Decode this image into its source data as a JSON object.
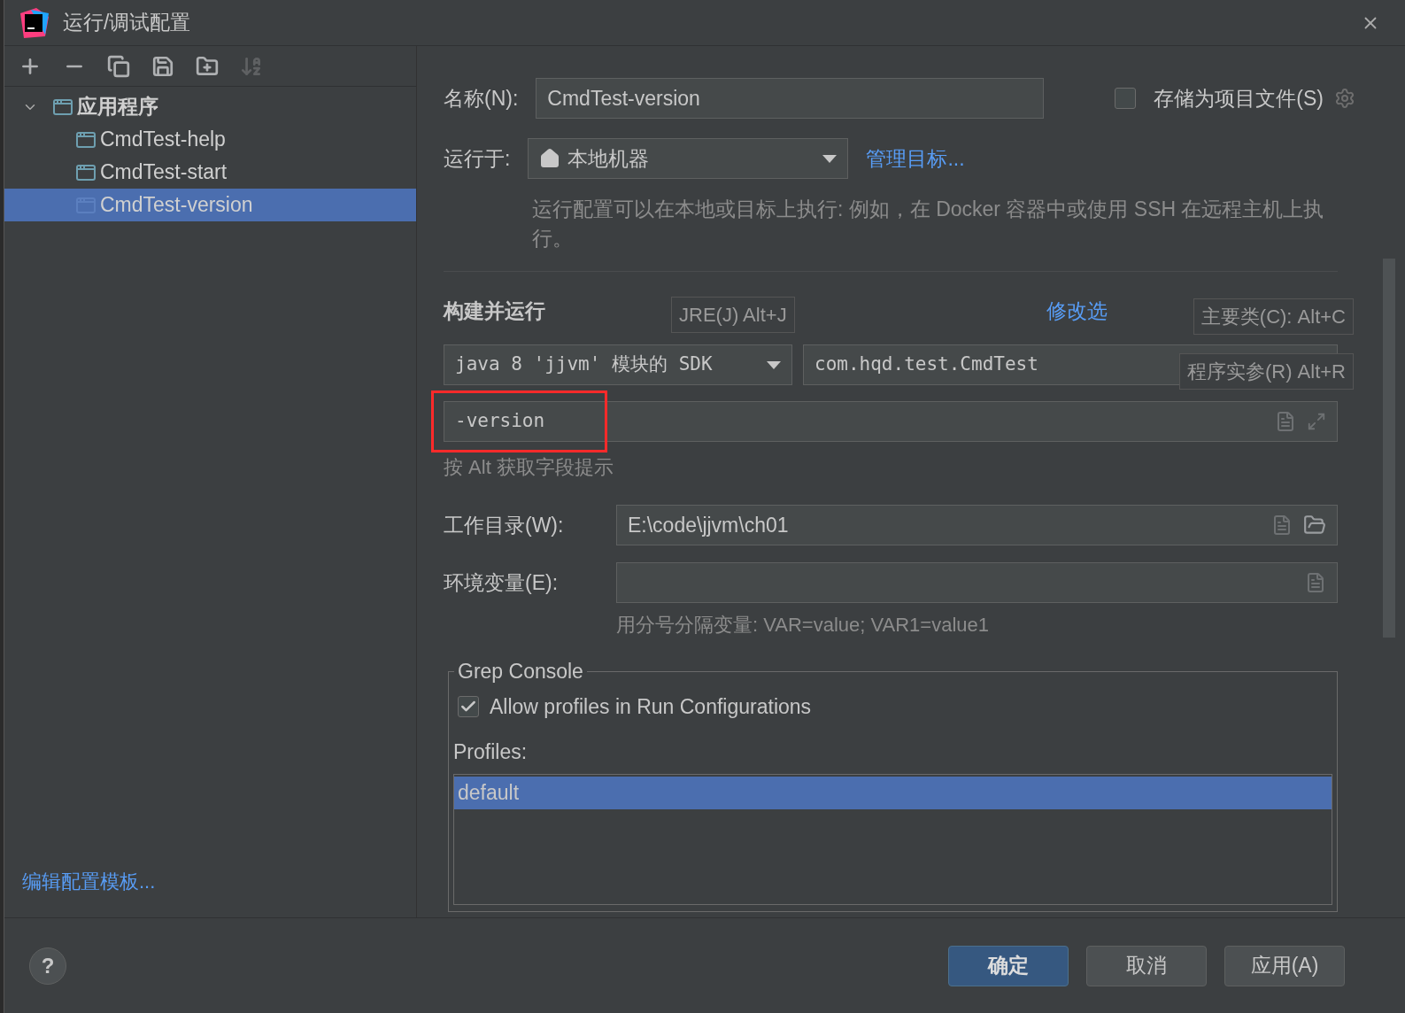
{
  "window": {
    "title": "运行/调试配置"
  },
  "toolbar": {
    "buttons": [
      {
        "kind": "add",
        "disabled": false
      },
      {
        "kind": "remove",
        "disabled": false
      },
      {
        "kind": "copy",
        "disabled": false
      },
      {
        "kind": "save",
        "disabled": false
      },
      {
        "kind": "folder",
        "disabled": false
      },
      {
        "kind": "sort",
        "disabled": true
      }
    ]
  },
  "tree": {
    "items": [
      {
        "label": "应用程序",
        "expanded": true,
        "selected": false,
        "children": [
          {
            "label": "CmdTest-help",
            "selected": false
          },
          {
            "label": "CmdTest-start",
            "selected": false
          },
          {
            "label": "CmdTest-version",
            "selected": true
          }
        ]
      }
    ]
  },
  "edit_templates_link": "编辑配置模板...",
  "help_button": "?",
  "form": {
    "name": {
      "label": "名称(N):",
      "value": "CmdTest-version"
    },
    "store_as_project_file": {
      "label": "存储为项目文件(S)",
      "checked": false
    },
    "run_on": {
      "label": "运行于:",
      "value": "本地机器",
      "link": "管理目标..."
    },
    "run_on_hint": "运行配置可以在本地或目标上执行: 例如，在 Docker 容器中或使用 SSH 在远程主机上执行。",
    "build_run": {
      "title": "构建并运行",
      "modify_options": "修改选",
      "jre": "java 8 'jjvm' 模块的 SDK",
      "main_class": "com.hqd.test.CmdTest",
      "program_args": {
        "value": "-version",
        "highlighted": true
      },
      "hint": "按 Alt 获取字段提示",
      "tooltips": [
        {
          "kind": "jre",
          "text": "JRE(J) Alt+J"
        },
        {
          "kind": "main_class",
          "text": "主要类(C): Alt+C"
        },
        {
          "kind": "args",
          "text": "程序实参(R) Alt+R"
        }
      ]
    },
    "working_dir": {
      "label": "工作目录(W):",
      "value": "E:\\code\\jjvm\\ch01"
    },
    "env": {
      "label": "环境变量(E):",
      "hint": "用分号分隔变量: VAR=value; VAR1=value1"
    }
  },
  "grep_console": {
    "title": "Grep Console",
    "allow_profiles": {
      "label": "Allow profiles in Run Configurations",
      "checked": true
    },
    "profiles_label": "Profiles:",
    "profiles": [
      {
        "label": "default",
        "selected": true
      }
    ]
  },
  "buttons": [
    {
      "label": "确定",
      "kind": "primary"
    },
    {
      "label": "取消",
      "kind": "normal"
    },
    {
      "label": "应用(A)",
      "kind": "normal"
    }
  ]
}
